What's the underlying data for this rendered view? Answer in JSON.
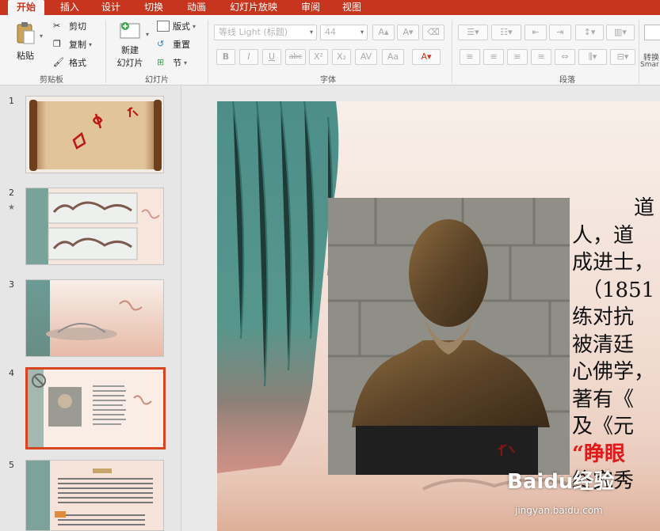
{
  "ribbon_tabs": [
    "开始",
    "插入",
    "设计",
    "切换",
    "动画",
    "幻灯片放映",
    "审阅",
    "视图"
  ],
  "clipboard": {
    "paste": "粘贴",
    "cut": "剪切",
    "copy": "复制",
    "format": "格式",
    "group": "剪贴板"
  },
  "slides_group": {
    "new_slide_line1": "新建",
    "new_slide_line2": "幻灯片",
    "layout": "版式",
    "reset": "重置",
    "section": "节",
    "group": "幻灯片"
  },
  "font": {
    "name_placeholder": "等线 Light (标题)",
    "size_placeholder": "44",
    "group": "字体"
  },
  "paragraph": {
    "group": "段落"
  },
  "convert": {
    "label_line1": "转换",
    "label_line2": "Smar"
  },
  "slide_numbers": [
    "1",
    "2",
    "3",
    "4",
    "5"
  ],
  "slide_marks": {
    "slide2_star": "★"
  },
  "main_text": {
    "lines": [
      "道",
      "人，道",
      "成进士，",
      "（1851",
      "练对抗",
      "被清廷",
      "心佛学，",
      "著有《",
      "及《元"
    ],
    "red_line": "“睁眼",
    "last_line": "终究秀"
  },
  "watermark": {
    "brand": "Baidu经验",
    "url": "jingyan.baidu.com"
  },
  "colors": {
    "accent": "#c8351e",
    "selected_border": "#d6451f"
  }
}
